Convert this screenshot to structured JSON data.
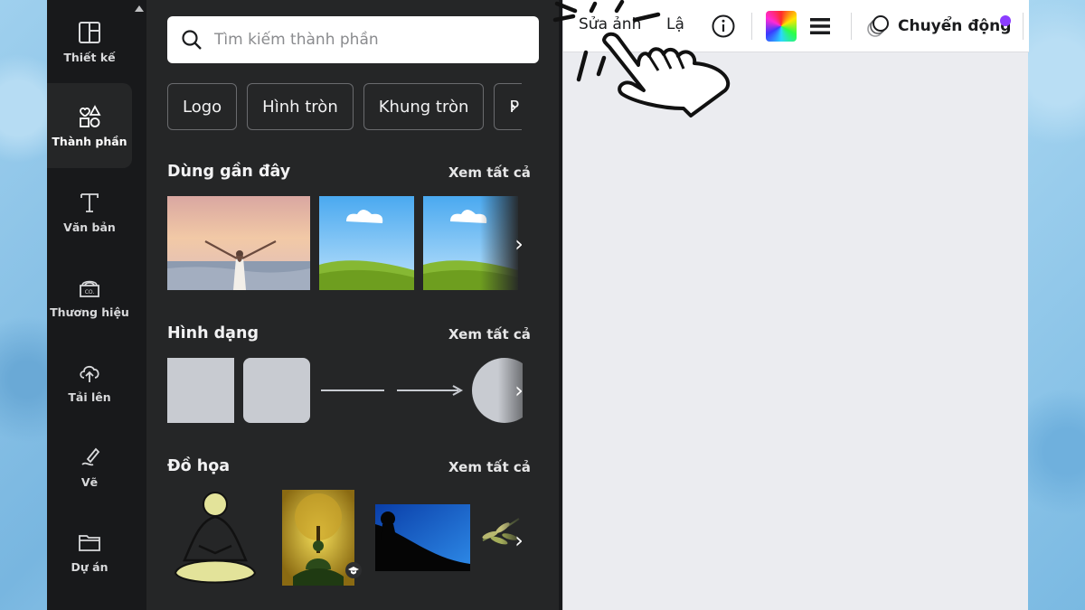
{
  "rail": {
    "items": [
      {
        "label": "Thiết kế"
      },
      {
        "label": "Thành phần"
      },
      {
        "label": "Văn bản"
      },
      {
        "label": "Thương hiệu"
      },
      {
        "label": "Tải lên"
      },
      {
        "label": "Vẽ"
      },
      {
        "label": "Dự án"
      }
    ]
  },
  "panel": {
    "search": {
      "placeholder": "Tìm kiếm thành phần"
    },
    "chips": [
      "Logo",
      "Hình tròn",
      "Khung tròn",
      "P"
    ],
    "sections": [
      {
        "title": "Dùng gần đây",
        "see_all": "Xem tất cả"
      },
      {
        "title": "Hình dạng",
        "see_all": "Xem tất cả"
      },
      {
        "title": "Đồ họa",
        "see_all": "Xem tất cả"
      }
    ]
  },
  "toolbar": {
    "edit_photo": "Sửa ảnh",
    "partial_item": "Lậ",
    "animate": "Chuyển động"
  },
  "colors": {
    "rail_bg": "#18191b",
    "panel_bg": "#252627",
    "canvas_bg": "#ebecf0",
    "notification_dot": "#8b3dff"
  },
  "icons": [
    "design-icon",
    "elements-icon",
    "text-icon",
    "brand-icon",
    "upload-icon",
    "draw-icon",
    "folder-icon",
    "search-icon",
    "info-icon",
    "color-palette-icon",
    "menu-icon",
    "animate-icon"
  ]
}
